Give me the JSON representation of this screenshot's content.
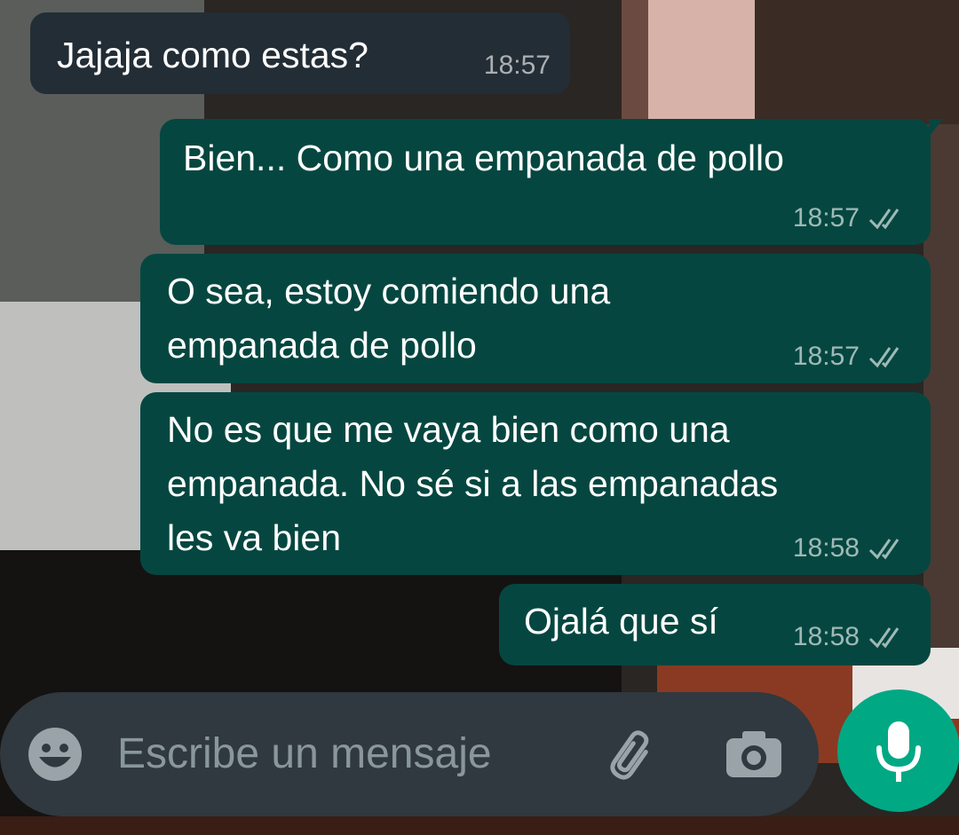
{
  "messages": [
    {
      "direction": "incoming",
      "text": "Jajaja como estas?",
      "time": "18:57"
    },
    {
      "direction": "outgoing",
      "text": "Bien... Como una empanada de pollo",
      "time": "18:57",
      "status": "double-check-icon"
    },
    {
      "direction": "outgoing",
      "lines": [
        "O sea, estoy comiendo una",
        "empanada de pollo"
      ],
      "time": "18:57",
      "status": "double-check-icon"
    },
    {
      "direction": "outgoing",
      "lines": [
        "No es que me vaya bien como una",
        "empanada. No sé si a las empanadas",
        "les va bien"
      ],
      "time": "18:58",
      "status": "double-check-icon"
    },
    {
      "direction": "outgoing",
      "text": "Ojalá que sí",
      "time": "18:58",
      "status": "double-check-icon"
    }
  ],
  "composer": {
    "placeholder": "Escribe un mensaje",
    "icons": [
      "emoji-icon",
      "paperclip-icon",
      "camera-icon",
      "microphone-icon"
    ]
  },
  "colors": {
    "incoming_bubble": "#232d36",
    "outgoing_bubble": "#054740",
    "composer_bg": "#2f393f",
    "mic_button": "#00a884",
    "placeholder_text": "#8a969d"
  }
}
